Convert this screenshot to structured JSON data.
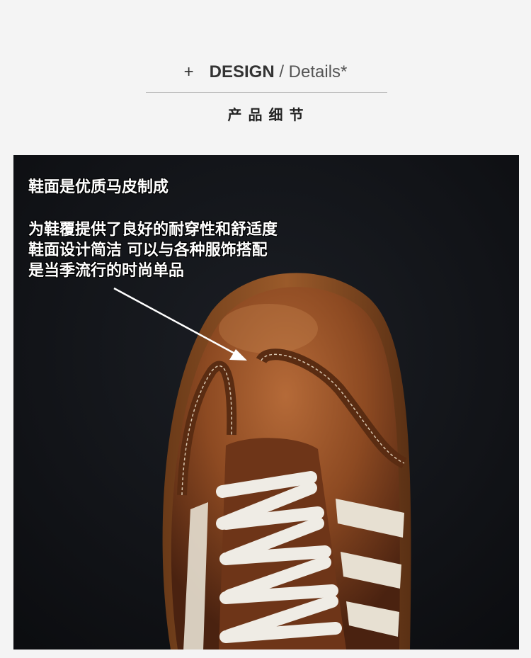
{
  "header": {
    "plus": "+",
    "design": "DESIGN",
    "slash_details": " / Details*",
    "subtitle": "产品细节"
  },
  "photo": {
    "caption_heading": "鞋面是优质马皮制成",
    "caption_lines": [
      "为鞋覆提供了良好的耐穿性和舒适度",
      "鞋面设计简洁 可以与各种服饰搭配",
      "是当季流行的时尚单品"
    ]
  },
  "colors": {
    "page_bg": "#f4f4f4",
    "photo_bg": "#101216",
    "leather": "#8a4a22",
    "laces": "#eeebe4"
  }
}
